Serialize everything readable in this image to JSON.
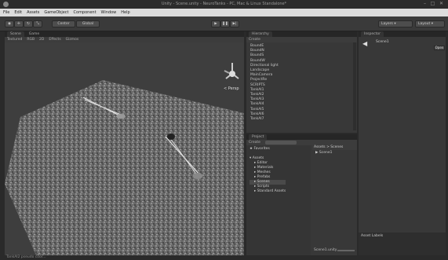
{
  "window": {
    "title": "Unity - Scene.unity - NeuroTanks - PC, Mac & Linux Standalone*"
  },
  "menu": [
    "File",
    "Edit",
    "Assets",
    "GameObject",
    "Component",
    "Window",
    "Help"
  ],
  "toolbar": {
    "pivot": "Center",
    "space": "Global",
    "layers": "Layers",
    "layout": "Layout"
  },
  "scene": {
    "tabs": [
      "Scene",
      "Game"
    ],
    "shading": "Textured",
    "render": "RGB",
    "mode": "2D",
    "effects": "Effects",
    "gizmos": "Gizmos",
    "persp": "< Persp"
  },
  "hierarchy": {
    "tab": "Hierarchy",
    "create": "Create",
    "items": [
      "BoundE",
      "BoundN",
      "BoundS",
      "BoundW",
      "Directional light",
      "Landscape",
      "MainCamera",
      "ProjectRe",
      "SCRIPTS",
      "TankAI1",
      "TankAI2",
      "TankAI3",
      "TankAI4",
      "TankAI5",
      "TankAI6",
      "TankAI7"
    ]
  },
  "project": {
    "tab": "Project",
    "create": "Create",
    "favorites": "Favorites",
    "assets_root": "Assets",
    "folders": [
      "Editor",
      "Materials",
      "Meshes",
      "Prefabs",
      "Scenes",
      "Scripts",
      "Standard Assets"
    ],
    "breadcrumb": "Assets > Scenes",
    "files": [
      "Scene1"
    ],
    "selected_file": "Scene1.unity"
  },
  "inspector": {
    "tab": "Inspector",
    "object": "Scene1",
    "button": "Open",
    "asset_labels": "Asset Labels"
  },
  "status": {
    "text": "TankAI2 pseudo coor..."
  }
}
